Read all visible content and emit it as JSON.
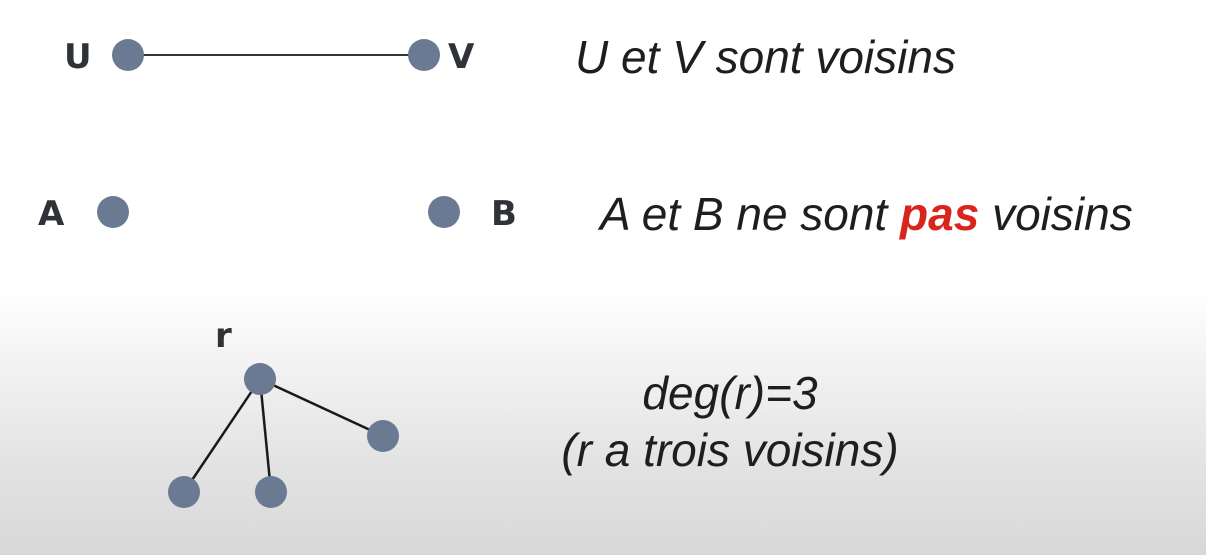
{
  "rows": [
    {
      "nodes": {
        "u": "U",
        "v": "V"
      },
      "caption": "U et V sont voisins"
    },
    {
      "nodes": {
        "a": "A",
        "b": "B"
      },
      "caption_before": "A et B ne sont ",
      "caption_emph": "pas",
      "caption_after": " voisins"
    },
    {
      "nodes": {
        "r": "r"
      },
      "caption_line1": "deg(r)=3",
      "caption_line2": "(r a trois voisins)"
    }
  ],
  "colors": {
    "node": "#6b7a93",
    "emphasis": "#d9251c"
  }
}
